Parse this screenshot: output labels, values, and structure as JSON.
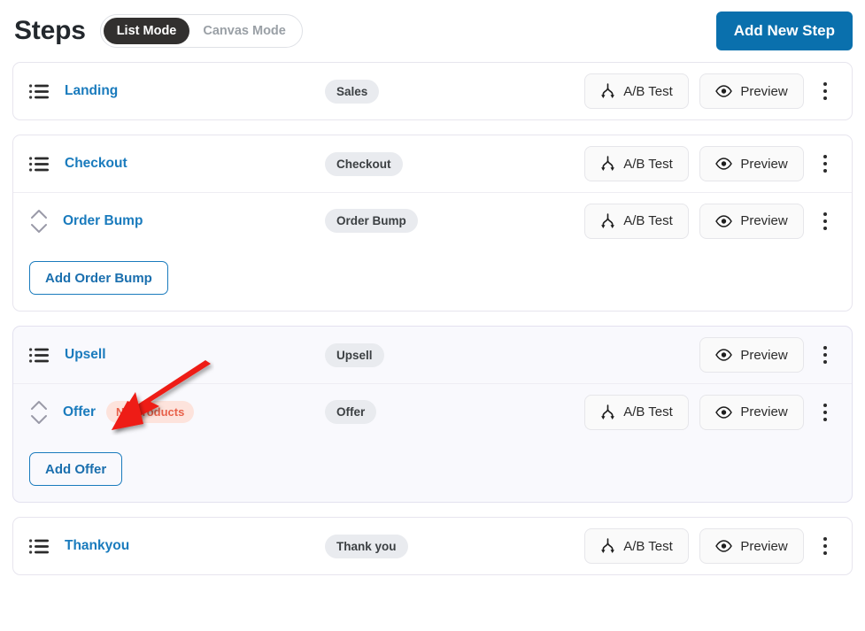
{
  "header": {
    "title": "Steps",
    "modes": [
      {
        "label": "List Mode",
        "active": true
      },
      {
        "label": "Canvas Mode",
        "active": false
      }
    ],
    "add_new_step_label": "Add New Step"
  },
  "labels": {
    "ab_test": "A/B Test",
    "preview": "Preview"
  },
  "colors": {
    "primary_blue": "#0a70ad",
    "link_blue": "#1a7bbd",
    "badge_bg": "#e9ebef",
    "warn_bg": "#fde3dc",
    "warn_text": "#e8614a",
    "highlight_card_bg": "#f9f9fd",
    "annotation_arrow": "#ee1c12"
  },
  "cards": [
    {
      "highlight": false,
      "rows": [
        {
          "handle_icon": "list-icon",
          "name": "Landing",
          "type_badge": "Sales",
          "warn_badge": null,
          "has_ab_test": true,
          "has_preview": true
        }
      ],
      "footer_button": null
    },
    {
      "highlight": false,
      "rows": [
        {
          "handle_icon": "list-icon",
          "name": "Checkout",
          "type_badge": "Checkout",
          "warn_badge": null,
          "has_ab_test": true,
          "has_preview": true
        },
        {
          "handle_icon": "sort-updown-icon",
          "name": "Order Bump",
          "type_badge": "Order Bump",
          "warn_badge": null,
          "has_ab_test": true,
          "has_preview": true
        }
      ],
      "footer_button": "Add Order Bump"
    },
    {
      "highlight": true,
      "rows": [
        {
          "handle_icon": "list-icon",
          "name": "Upsell",
          "type_badge": "Upsell",
          "warn_badge": null,
          "has_ab_test": false,
          "has_preview": true
        },
        {
          "handle_icon": "sort-updown-icon",
          "name": "Offer",
          "type_badge": "Offer",
          "warn_badge": "No Products",
          "has_ab_test": true,
          "has_preview": true
        }
      ],
      "footer_button": "Add Offer"
    },
    {
      "highlight": false,
      "rows": [
        {
          "handle_icon": "list-icon",
          "name": "Thankyou",
          "type_badge": "Thank you",
          "warn_badge": null,
          "has_ab_test": true,
          "has_preview": true
        }
      ],
      "footer_button": null
    }
  ]
}
